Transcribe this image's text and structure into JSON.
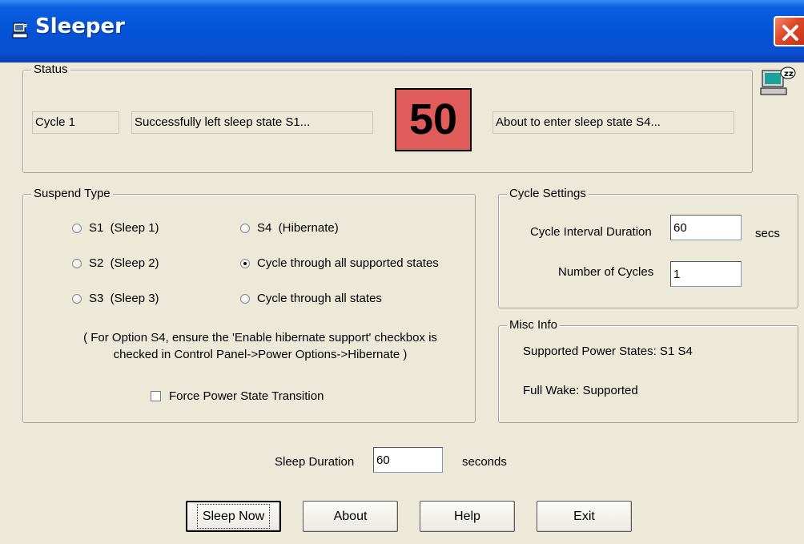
{
  "window": {
    "title": "Sleeper"
  },
  "status": {
    "legend": "Status",
    "cycle": "Cycle 1",
    "left_message": "Successfully left sleep state S1...",
    "countdown": "50",
    "right_message": "About to enter sleep state S4..."
  },
  "suspend": {
    "legend": "Suspend Type",
    "options": [
      {
        "label": "S1  (Sleep 1)",
        "checked": false
      },
      {
        "label": "S2  (Sleep 2)",
        "checked": false
      },
      {
        "label": "S3  (Sleep 3)",
        "checked": false
      },
      {
        "label": "S4  (Hibernate)",
        "checked": false
      },
      {
        "label": "Cycle through all supported states",
        "checked": true
      },
      {
        "label": "Cycle through all states",
        "checked": false
      }
    ],
    "note": "( For Option S4, ensure the 'Enable hibernate support' checkbox is checked in Control Panel->Power Options->Hibernate )",
    "force_label": "Force Power State Transition",
    "force_checked": false
  },
  "cycle_settings": {
    "legend": "Cycle Settings",
    "interval_label": "Cycle Interval Duration",
    "interval_value": "60",
    "interval_unit": "secs",
    "count_label": "Number of Cycles",
    "count_value": "1"
  },
  "misc": {
    "legend": "Misc Info",
    "power_states": "Supported Power States: S1 S4",
    "full_wake": "Full Wake: Supported"
  },
  "sleep": {
    "label": "Sleep Duration",
    "value": "60",
    "unit": "seconds"
  },
  "buttons": {
    "sleep_now": "Sleep Now",
    "about": "About",
    "help": "Help",
    "exit": "Exit"
  }
}
